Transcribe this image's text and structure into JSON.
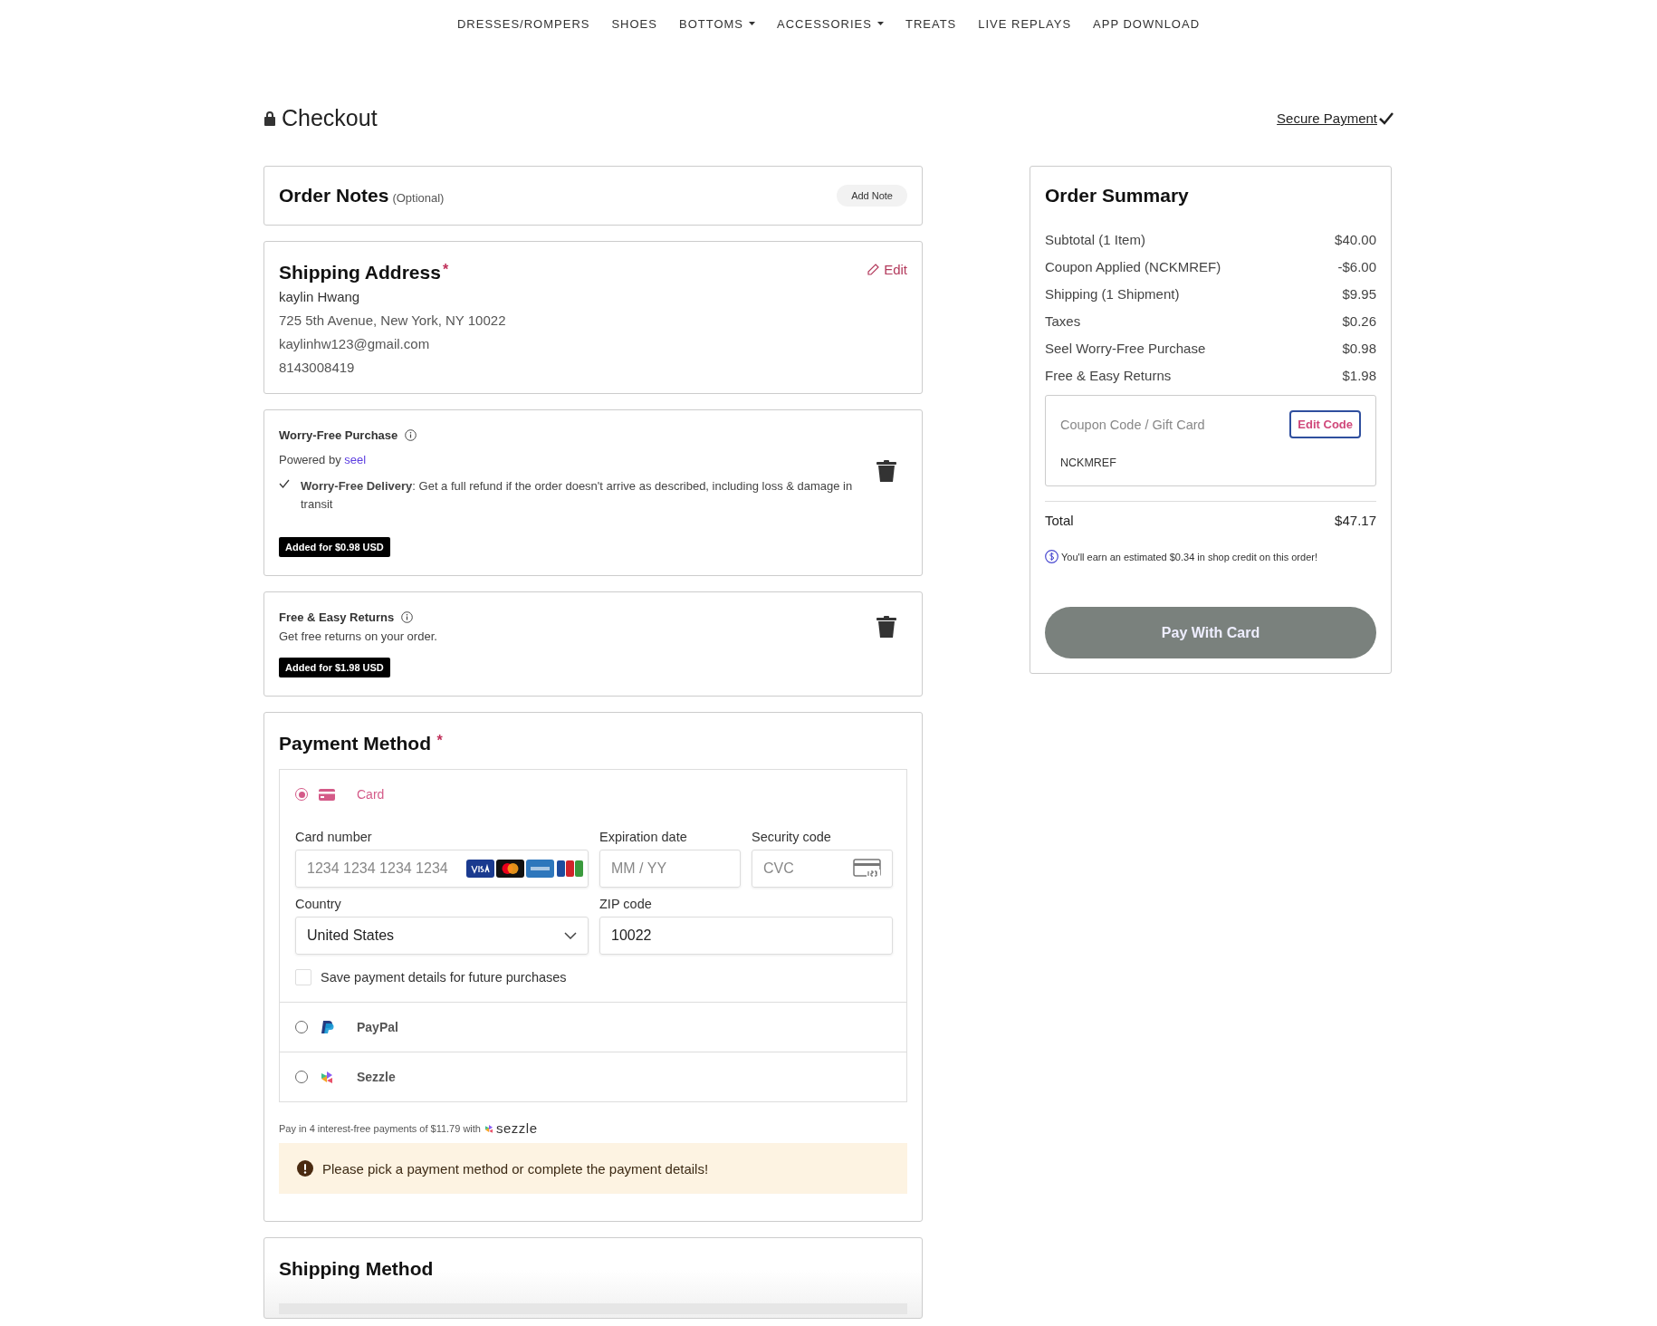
{
  "nav": [
    {
      "label": "DRESSES/ROMPERS",
      "has_dropdown": false
    },
    {
      "label": "SHOES",
      "has_dropdown": false
    },
    {
      "label": "BOTTOMS",
      "has_dropdown": true
    },
    {
      "label": "ACCESSORIES",
      "has_dropdown": true
    },
    {
      "label": "TREATS",
      "has_dropdown": false
    },
    {
      "label": "LIVE REPLAYS",
      "has_dropdown": false
    },
    {
      "label": "APP DOWNLOAD",
      "has_dropdown": false
    }
  ],
  "page_title": "Checkout",
  "secure_link": "Secure Payment",
  "order_notes": {
    "title": "Order Notes",
    "hint": "(Optional)",
    "button": "Add Note"
  },
  "shipping_address": {
    "title": "Shipping Address",
    "required_mark": "*",
    "edit": "Edit",
    "lines": [
      "kaylin Hwang",
      "725 5th Avenue, New York, NY 10022",
      "kaylinhw123@gmail.com",
      "8143008419"
    ]
  },
  "protections": [
    {
      "kind": "seel",
      "title": "Worry-Free Purchase",
      "powered_by": "Powered by",
      "brand": "seel",
      "feature": "**Worry-Free Delivery**: Get a full refund if the order doesn't arrive as described, including loss & damage in transit",
      "badge": "Added for $0.98 USD"
    },
    {
      "kind": "returns",
      "title": "Free & Easy Returns",
      "description": "Get free returns on your order.",
      "badge": "Added for $1.98 USD"
    }
  ],
  "payment": {
    "title": "Payment Method",
    "required_mark": "*",
    "methods": [
      {
        "kind": "card",
        "label": "Card",
        "selected": true
      },
      {
        "kind": "paypal",
        "label": "PayPal",
        "selected": false
      },
      {
        "kind": "sezzle",
        "label": "Sezzle",
        "selected": false
      }
    ],
    "card_form": {
      "card_number_label": "Card number",
      "card_number_placeholder": "1234 1234 1234 1234",
      "expiry_label": "Expiration date",
      "expiry_placeholder": "MM / YY",
      "cvc_label": "Security code",
      "cvc_placeholder": "CVC",
      "country_label": "Country",
      "country_value": "United States",
      "zip_label": "ZIP code",
      "zip_value": "10022",
      "save_label": "Save payment details for future purchases",
      "save_checked": false
    },
    "installments_text": "Pay in 4 interest-free payments of $11.79 with",
    "installments_brand": "sezzle",
    "alert": "Please pick a payment method or complete the payment details!"
  },
  "shipping_method": {
    "title": "Shipping Method"
  },
  "summary": {
    "title": "Order Summary",
    "lines": [
      {
        "label": "Subtotal (1 Item)",
        "amount": "$40.00"
      },
      {
        "label": "Coupon Applied (NCKMREF)",
        "amount": "-$6.00"
      },
      {
        "label": "Shipping (1 Shipment)",
        "amount": "$9.95"
      },
      {
        "label": "Taxes",
        "amount": "$0.26"
      },
      {
        "label": "Seel Worry-Free Purchase",
        "amount": "$0.98"
      },
      {
        "label": "Free & Easy Returns",
        "amount": "$1.98"
      }
    ],
    "coupon": {
      "placeholder": "Coupon Code / Gift Card",
      "button": "Edit Code",
      "code": "NCKMREF"
    },
    "total": {
      "label": "Total",
      "amount": "$47.17"
    },
    "credit_note": "You'll earn an estimated $0.34 in shop credit on this order!",
    "pay_button": "Pay With Card"
  }
}
